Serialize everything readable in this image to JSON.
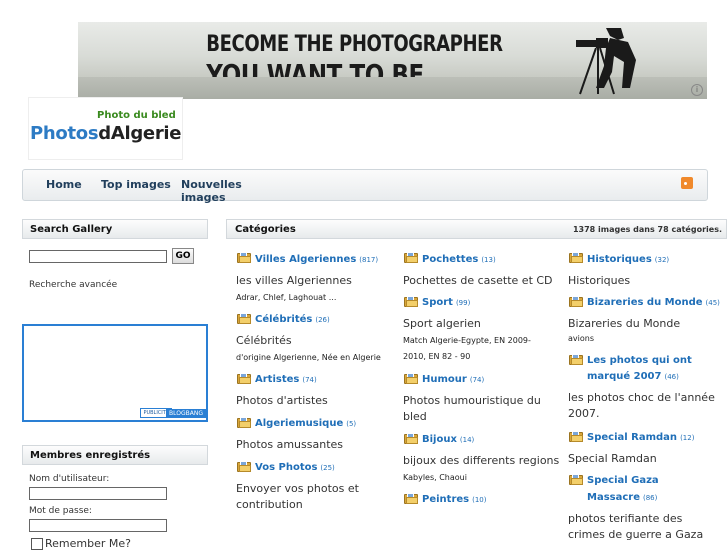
{
  "banner": {
    "line1": "BECOME THE PHOTOGRAPHER",
    "line2": "YOU WANT TO BE.",
    "info": "i"
  },
  "logo": {
    "tagline": "Photo du bled",
    "brand_part1": "Photos",
    "brand_part2": "dAlgerie"
  },
  "nav": {
    "items": [
      "Home",
      "Top images",
      "Nouvelles images"
    ]
  },
  "search": {
    "title": "Search Gallery",
    "go": "GO",
    "advanced": "Recherche avancée"
  },
  "ad": {
    "publicite": "PUBLICITE",
    "brand": "BLOGBANG"
  },
  "members": {
    "title": "Membres enregistrés",
    "username_label": "Nom d'utilisateur:",
    "password_label": "Mot de passe:",
    "remember": "Remember Me?"
  },
  "categories": {
    "title": "Catégories",
    "count": "1378 images dans 78 catégories.",
    "col1": [
      {
        "name": "Villes Algeriennes",
        "count": "(817)",
        "desc": "les villes Algeriennes",
        "sub": "Adrar, Chlef, Laghouat ..."
      },
      {
        "name": "Célébrités",
        "count": "(26)",
        "desc": "Célébrités",
        "sub": "d'origine Algerienne, Née en Algerie"
      },
      {
        "name": "Artistes",
        "count": "(74)",
        "desc": "Photos d'artistes",
        "sub": ""
      },
      {
        "name": "Algeriemusique",
        "count": "(5)",
        "desc": "Photos amussantes",
        "sub": ""
      },
      {
        "name": "Vos Photos",
        "count": "(25)",
        "desc": "Envoyer vos photos et contribution",
        "sub": ""
      }
    ],
    "col2": [
      {
        "name": "Pochettes",
        "count": "(13)",
        "desc": "Pochettes de casette et CD",
        "sub": ""
      },
      {
        "name": "Sport",
        "count": "(99)",
        "desc": "Sport algerien",
        "sub": "Match Algerie-Egypte, EN 2009-2010, EN 82 - 90"
      },
      {
        "name": "Humour",
        "count": "(74)",
        "desc": "Photos humouristique du bled",
        "sub": ""
      },
      {
        "name": "Bijoux",
        "count": "(14)",
        "desc": "bijoux des differents regions",
        "sub": "Kabyles, Chaoui"
      },
      {
        "name": "Peintres",
        "count": "(10)",
        "desc": "",
        "sub": ""
      }
    ],
    "col3": [
      {
        "name": "Historiques",
        "count": "(32)",
        "desc": "Historiques",
        "sub": ""
      },
      {
        "name": "Bizareries du Monde",
        "count": "(45)",
        "desc": "Bizareries du Monde",
        "sub": "avions"
      },
      {
        "name_line1": "Les photos qui ont",
        "name_line2": "marqué 2007",
        "count": "(46)",
        "desc": "les photos choc de l'année 2007.",
        "sub": ""
      },
      {
        "name": "Special Ramdan",
        "count": "(12)",
        "desc": "Special Ramdan",
        "sub": ""
      },
      {
        "name_line1": "Special Gaza",
        "name_line2": "Massacre",
        "count": "(86)",
        "desc": "photos terifiante des crimes de guerre a Gaza",
        "sub": ""
      }
    ]
  }
}
